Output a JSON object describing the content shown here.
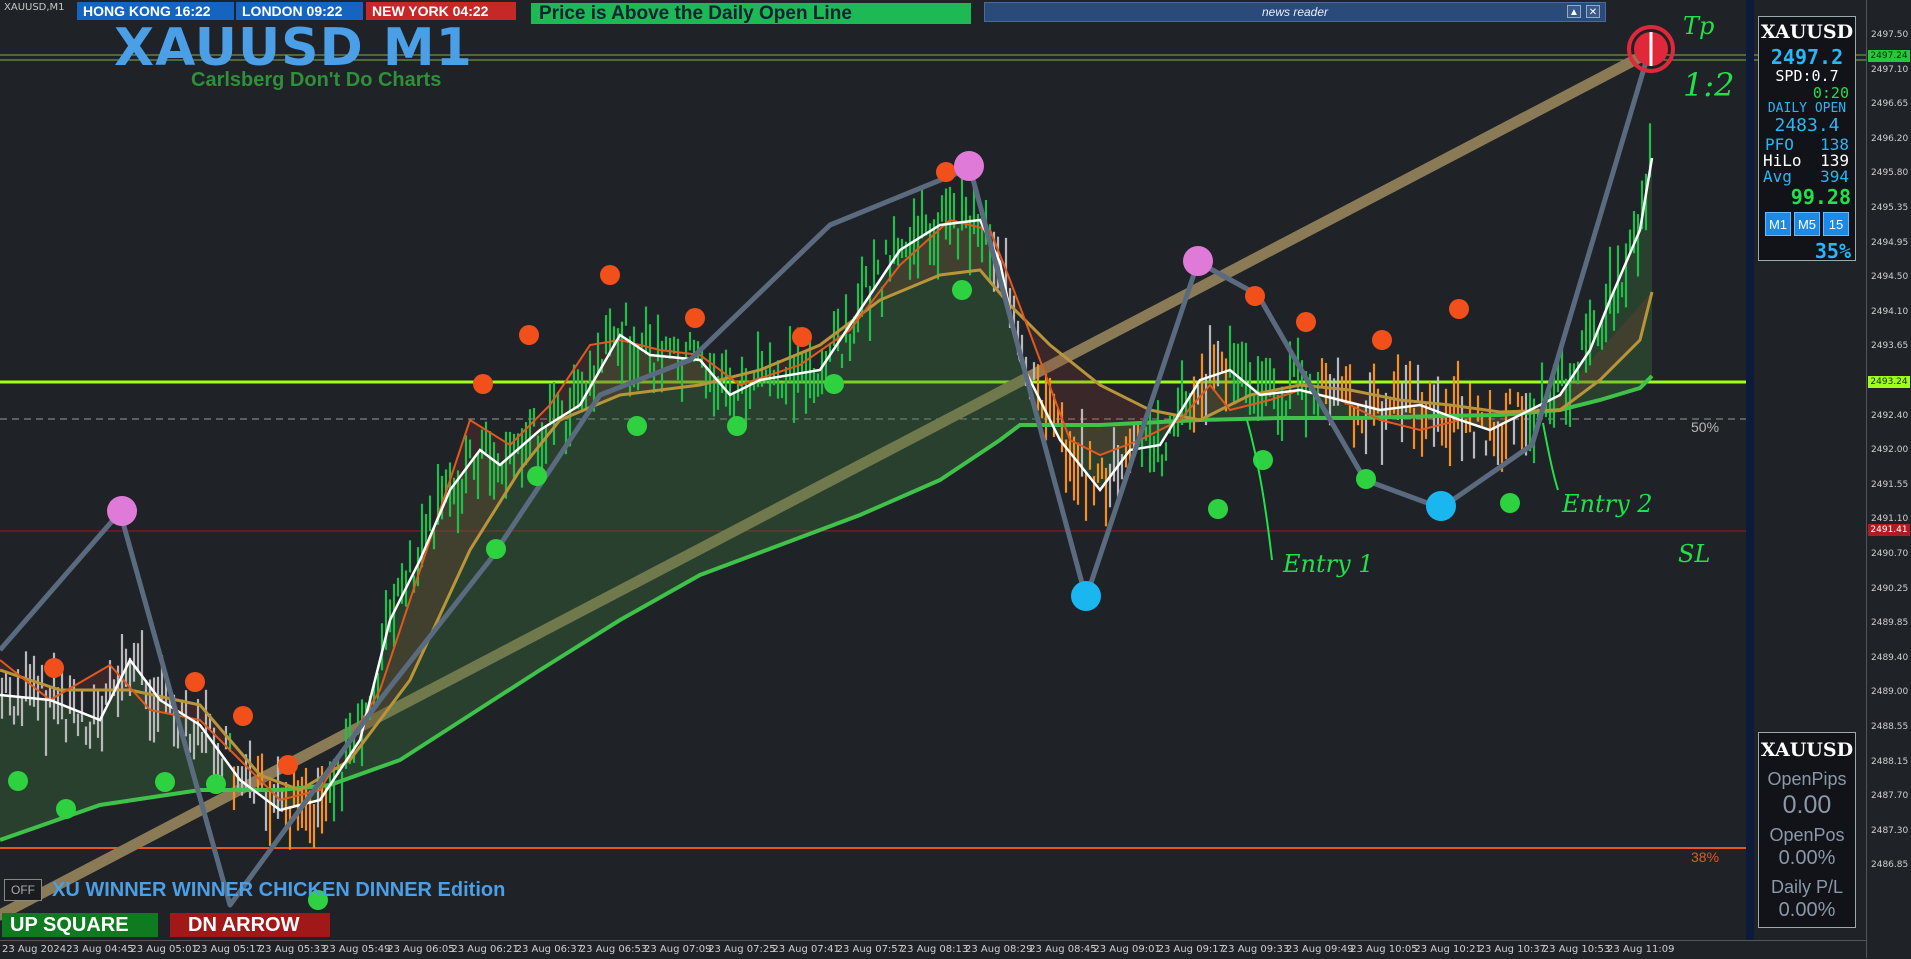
{
  "window": {
    "tab_title": "XAUUSD,M1"
  },
  "clocks": [
    {
      "label": "HONG KONG 16:22",
      "color": "#1565c0"
    },
    {
      "label": "LONDON  09:22",
      "color": "#1565c0"
    },
    {
      "label": "NEW YORK  04:22",
      "color": "#c62828"
    }
  ],
  "status_banner": "Price is Above the Daily Open Line",
  "news_reader": {
    "title": "news reader"
  },
  "chart_header": {
    "symbol_title": "XAUUSD M1",
    "subtitle": "Carlsberg Don't Do Charts"
  },
  "info_panel": {
    "symbol": "XAUUSD",
    "price": "2497.2",
    "spread": "SPD:0.7",
    "timer": "0:20",
    "daily_open_label": "DAILY OPEN",
    "daily_open_value": "2483.4",
    "pfo_label": "PFO",
    "pfo_value": "138",
    "hilo_label": "HiLo",
    "hilo_value": "139",
    "avg_label": "Avg",
    "avg_value": "394",
    "score": "99.28",
    "timeframes": [
      "M1",
      "M5",
      "15"
    ],
    "percent": "35%"
  },
  "trade_panel": {
    "symbol": "XAUUSD",
    "open_pips_label": "OpenPips",
    "open_pips_value": "0.00",
    "open_pos_label": "OpenPos",
    "open_pos_value": "0.00%",
    "daily_pl_label": "Daily P/L",
    "daily_pl_value": "0.00%"
  },
  "bottom": {
    "off_label": "OFF",
    "edition_title": "XU WINNER WINNER CHICKEN DINNER Edition",
    "up_square": "UP SQUARE",
    "dn_arrow": "DN ARROW"
  },
  "fib_labels": {
    "fifty": "50%",
    "thirty_eight": "38%"
  },
  "annotations": {
    "tp": "Tp",
    "rr": "1:2",
    "entry1": "Entry 1",
    "entry2": "Entry 2",
    "sl": "SL"
  },
  "price_axis": {
    "labels": [
      "2497.50",
      "2497.10",
      "2496.65",
      "2496.20",
      "2495.80",
      "2495.35",
      "2494.95",
      "2494.50",
      "2494.10",
      "2493.65",
      "2492.80",
      "2492.40",
      "2492.00",
      "2491.55",
      "2491.10",
      "2490.70",
      "2490.25",
      "2489.85",
      "2489.40",
      "2489.00",
      "2488.55",
      "2488.15",
      "2487.70",
      "2487.30",
      "2486.85"
    ],
    "current_price_box": "2497.24",
    "green_line_box": "2493.24",
    "red_line_box": "2491.41"
  },
  "time_axis": {
    "labels": [
      "23 Aug 2024",
      "23 Aug 04:45",
      "23 Aug 05:01",
      "23 Aug 05:17",
      "23 Aug 05:33",
      "23 Aug 05:49",
      "23 Aug 06:05",
      "23 Aug 06:21",
      "23 Aug 06:37",
      "23 Aug 06:53",
      "23 Aug 07:09",
      "23 Aug 07:25",
      "23 Aug 07:41",
      "23 Aug 07:57",
      "23 Aug 08:13",
      "23 Aug 08:29",
      "23 Aug 08:45",
      "23 Aug 09:01",
      "23 Aug 09:17",
      "23 Aug 09:33",
      "23 Aug 09:49",
      "23 Aug 10:05",
      "23 Aug 10:21",
      "23 Aug 10:37",
      "23 Aug 10:53",
      "23 Aug 11:09"
    ]
  },
  "colors": {
    "bull_bar": "#1fbf4a",
    "bear_bar": "#f5901e",
    "neutral_bar": "#b9b9b9",
    "fast_ma": "#ffffff",
    "mid_ma": "#e05a20",
    "slow_ma": "#b8953a",
    "long_ma": "#3fc24a",
    "zigzag": "#5a6b80",
    "trend_line": "#8a7a55",
    "daily_open_line": "#9eff1a",
    "sl_line": "#a01820",
    "fib38_line": "#e8581e",
    "pivot_high": "#f2501a",
    "pivot_low": "#2ed13f",
    "major_high": "#e07ad8",
    "major_low": "#19b6f0"
  }
}
